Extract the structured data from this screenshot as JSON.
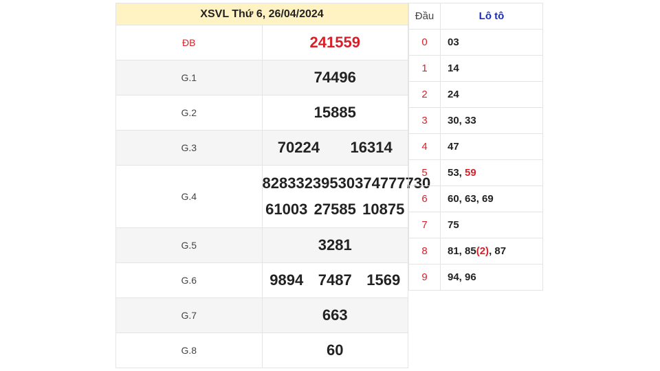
{
  "header": {
    "title": "XSVL Thứ 6, 26/04/2024"
  },
  "prizes": {
    "db": {
      "label": "ĐB",
      "numbers": [
        "241559"
      ]
    },
    "g1": {
      "label": "G.1",
      "numbers": [
        "74496"
      ]
    },
    "g2": {
      "label": "G.2",
      "numbers": [
        "15885"
      ]
    },
    "g3": {
      "label": "G.3",
      "numbers": [
        "70224",
        "16314"
      ]
    },
    "g4": {
      "label": "G.4",
      "line1": [
        "82833",
        "23953",
        "03747",
        "77730"
      ],
      "line2": [
        "61003",
        "27585",
        "10875"
      ]
    },
    "g5": {
      "label": "G.5",
      "numbers": [
        "3281"
      ]
    },
    "g6": {
      "label": "G.6",
      "numbers": [
        "9894",
        "7487",
        "1569"
      ]
    },
    "g7": {
      "label": "G.7",
      "numbers": [
        "663"
      ]
    },
    "g8": {
      "label": "G.8",
      "numbers": [
        "60"
      ]
    }
  },
  "loto": {
    "head_dau": "Đầu",
    "head_loto": "Lô tô",
    "rows": [
      {
        "dau": "0",
        "parts": [
          {
            "text": "03"
          }
        ]
      },
      {
        "dau": "1",
        "parts": [
          {
            "text": "14"
          }
        ]
      },
      {
        "dau": "2",
        "parts": [
          {
            "text": "24"
          }
        ]
      },
      {
        "dau": "3",
        "parts": [
          {
            "text": "30, 33"
          }
        ]
      },
      {
        "dau": "4",
        "parts": [
          {
            "text": "47"
          }
        ]
      },
      {
        "dau": "5",
        "parts": [
          {
            "text": "53, "
          },
          {
            "text": "59",
            "red": true
          }
        ]
      },
      {
        "dau": "6",
        "parts": [
          {
            "text": "60, 63, 69"
          }
        ]
      },
      {
        "dau": "7",
        "parts": [
          {
            "text": "75"
          }
        ]
      },
      {
        "dau": "8",
        "parts": [
          {
            "text": "81, 85"
          },
          {
            "text": "(2)",
            "red": true
          },
          {
            "text": ", 87"
          }
        ]
      },
      {
        "dau": "9",
        "parts": [
          {
            "text": "94, 96"
          }
        ]
      }
    ]
  },
  "colors": {
    "accent_red": "#d9202a",
    "header_bg": "#fff3c4",
    "loto_head": "#1a2fb5"
  }
}
